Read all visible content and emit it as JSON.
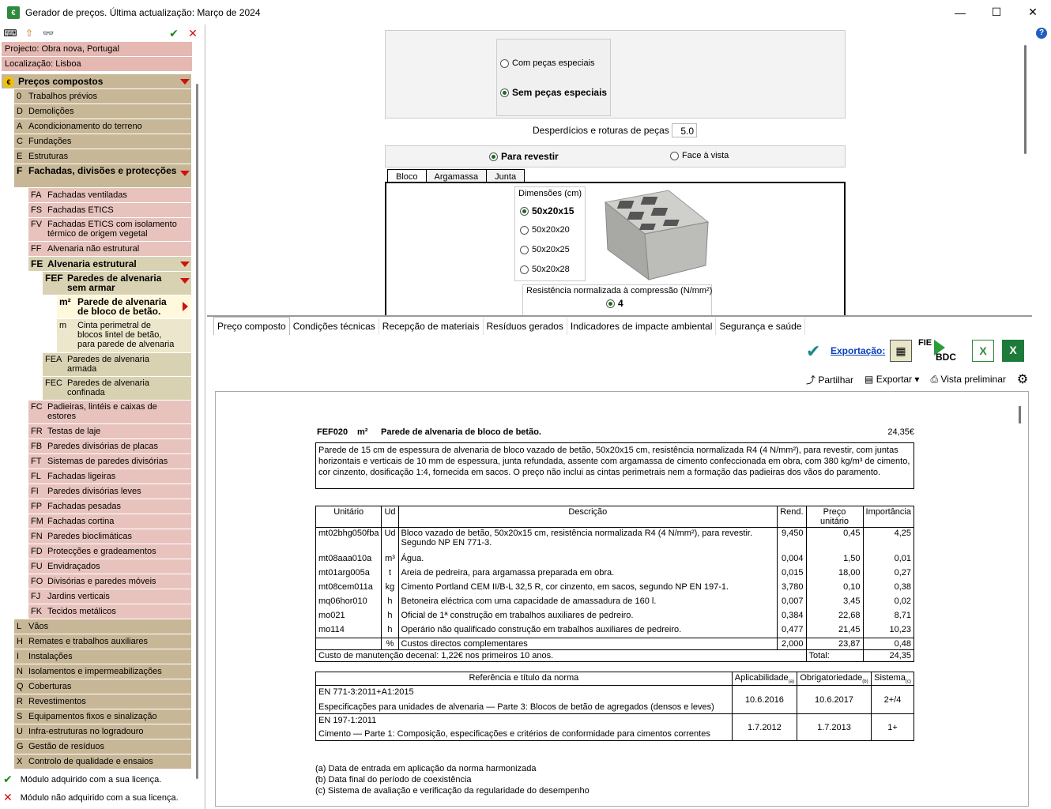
{
  "window": {
    "title": "Gerador de preços. Última actualização: Março de 2024",
    "minimize": "—",
    "maximize": "☐",
    "close": "✕"
  },
  "left": {
    "project": "Projecto: Obra nova, Portugal",
    "location": "Localização: Lisboa",
    "root": "Preços compostos",
    "chapters_top": [
      {
        "code": "0",
        "label": "Trabalhos prévios"
      },
      {
        "code": "D",
        "label": "Demolições"
      },
      {
        "code": "A",
        "label": "Acondicionamento do terreno"
      },
      {
        "code": "C",
        "label": "Fundações"
      },
      {
        "code": "E",
        "label": "Estruturas"
      }
    ],
    "chapter_f": {
      "code": "F",
      "label": "Fachadas, divisões e protecções"
    },
    "f_items_a": [
      {
        "code": "FA",
        "label": "Fachadas ventiladas"
      },
      {
        "code": "FS",
        "label": "Fachadas ETICS"
      },
      {
        "code": "FV",
        "label": "Fachadas ETICS com isolamento térmico de origem vegetal"
      },
      {
        "code": "FF",
        "label": "Alvenaria não estrutural"
      }
    ],
    "fe": {
      "code": "FE",
      "label": "Alvenaria estrutural"
    },
    "fef": {
      "code": "FEF",
      "label": "Paredes de alvenaria sem armar"
    },
    "m2": {
      "code": "m²",
      "label": "Parede de alvenaria de bloco de betão."
    },
    "m": {
      "code": "m",
      "label": "Cinta perimetral de blocos lintel de betão, para parede de alvenaria"
    },
    "fea": {
      "code": "FEA",
      "label": "Paredes de alvenaria armada"
    },
    "fec": {
      "code": "FEC",
      "label": "Paredes de alvenaria confinada"
    },
    "f_items_b": [
      {
        "code": "FC",
        "label": "Padieiras, lintéis e caixas de estores"
      },
      {
        "code": "FR",
        "label": "Testas de laje"
      },
      {
        "code": "FB",
        "label": "Paredes divisórias de placas"
      },
      {
        "code": "FT",
        "label": "Sistemas de paredes divisórias"
      },
      {
        "code": "FL",
        "label": "Fachadas ligeiras"
      },
      {
        "code": "FI",
        "label": "Paredes divisórias leves"
      },
      {
        "code": "FP",
        "label": "Fachadas pesadas"
      },
      {
        "code": "FM",
        "label": "Fachadas cortina"
      },
      {
        "code": "FN",
        "label": "Paredes bioclimáticas"
      },
      {
        "code": "FD",
        "label": "Protecções e gradeamentos"
      },
      {
        "code": "FU",
        "label": "Envidraçados"
      },
      {
        "code": "FO",
        "label": "Divisórias e paredes móveis"
      },
      {
        "code": "FJ",
        "label": "Jardins verticais"
      },
      {
        "code": "FK",
        "label": "Tecidos metálicos"
      }
    ],
    "chapters_bottom": [
      {
        "code": "L",
        "label": "Vãos"
      },
      {
        "code": "H",
        "label": "Remates e trabalhos auxiliares"
      },
      {
        "code": "I",
        "label": "Instalações"
      },
      {
        "code": "N",
        "label": "Isolamentos e impermeabilizações"
      },
      {
        "code": "Q",
        "label": "Coberturas"
      },
      {
        "code": "R",
        "label": "Revestimentos"
      },
      {
        "code": "S",
        "label": "Equipamentos fixos e sinalização"
      },
      {
        "code": "U",
        "label": "Infra-estruturas no logradouro"
      },
      {
        "code": "G",
        "label": "Gestão de resíduos"
      },
      {
        "code": "X",
        "label": "Controlo de qualidade e ensaios"
      }
    ],
    "legend_ok": "Módulo adquirido com a sua licença.",
    "legend_no": "Módulo não adquirido com a sua licença."
  },
  "options": {
    "special_on": "Com peças especiais",
    "special_off": "Sem peças especiais",
    "waste_label": "Desperdícios e roturas de peças (%)",
    "waste_value": "5.0",
    "finish_render": "Para revestir",
    "finish_face": "Face à vista",
    "tabs": [
      "Bloco",
      "Argamassa",
      "Junta"
    ],
    "dims_title": "Dimensões (cm)",
    "dims": [
      "50x20x15",
      "50x20x20",
      "50x20x25",
      "50x20x28"
    ],
    "resist_title": "Resistência normalizada à compressão (N/mm²)",
    "resist_value": "4"
  },
  "bottom": {
    "tabs": [
      "Preço composto",
      "Condições técnicas",
      "Recepção de materiais",
      "Resíduos gerados",
      "Indicadores de impacte ambiental",
      "Segurança e saúde"
    ],
    "export_link": "Exportação:",
    "fie": "FIE",
    "bdc": "BDC",
    "share": "Partilhar",
    "export": "Exportar",
    "preview": "Vista preliminar"
  },
  "doc": {
    "code": "FEF020",
    "unit": "m²",
    "title": "Parede de alvenaria de bloco de betão.",
    "price": "24,35€",
    "description": "Parede de 15 cm de espessura de alvenaria de bloco vazado de betão, 50x20x15 cm, resistência normalizada R4 (4 N/mm²), para revestir, com juntas horizontais e verticais de 10 mm de espessura, junta refundada, assente com argamassa de cimento confeccionada em obra, com 380 kg/m³ de cimento, cor cinzento, dosificação 1:4, fornecida em sacos. O preço não inclui as cintas perimetrais nem a formação das padieiras dos vãos do paramento.",
    "headers": [
      "Unitário",
      "Ud",
      "Descrição",
      "Rend.",
      "Preço unitário",
      "Importância"
    ],
    "rows": [
      [
        "mt02bhg050fba",
        "Ud",
        "Bloco vazado de betão, 50x20x15 cm, resistência normalizada R4 (4 N/mm²), para revestir. Segundo NP EN 771-3.",
        "9,450",
        "0,45",
        "4,25"
      ],
      [
        "mt08aaa010a",
        "m³",
        "Água.",
        "0,004",
        "1,50",
        "0,01"
      ],
      [
        "mt01arg005a",
        "t",
        "Areia de pedreira, para argamassa preparada em obra.",
        "0,015",
        "18,00",
        "0,27"
      ],
      [
        "mt08cem011a",
        "kg",
        "Cimento Portland CEM II/B-L 32,5 R, cor cinzento, em sacos, segundo NP EN 197-1.",
        "3,780",
        "0,10",
        "0,38"
      ],
      [
        "mq06hor010",
        "h",
        "Betoneira eléctrica com uma capacidade de amassadura de 160 l.",
        "0,007",
        "3,45",
        "0,02"
      ],
      [
        "mo021",
        "h",
        "Oficial de 1ª construção em trabalhos auxiliares de pedreiro.",
        "0,384",
        "22,68",
        "8,71"
      ],
      [
        "mo114",
        "h",
        "Operário não qualificado construção em trabalhos auxiliares de pedreiro.",
        "0,477",
        "21,45",
        "10,23"
      ]
    ],
    "extra": [
      "",
      "%",
      "Custos directos complementares",
      "2,000",
      "23,87",
      "0,48"
    ],
    "maintenance": "Custo de manutenção decenal: 1,22€ nos primeiros 10 anos.",
    "total_label": "Total:",
    "total": "24,35",
    "norm_headers": [
      "Referência e título da norma",
      "Aplicabilidade",
      "Obrigatoriedade",
      "Sistema"
    ],
    "norm_sub": [
      "(a)",
      "(b)",
      "(c)"
    ],
    "norms": [
      {
        "ref": "EN  771-3:2011+A1:2015",
        "title": "Especificações para unidades de alvenaria — Parte 3: Blocos de betão de agregados (densos e leves)",
        "app": "10.6.2016",
        "obl": "10.6.2017",
        "sys": "2+/4"
      },
      {
        "ref": "EN  197-1:2011",
        "title": "Cimento — Parte 1: Composição, especificações e critérios de conformidade para cimentos correntes",
        "app": "1.7.2012",
        "obl": "1.7.2013",
        "sys": "1+"
      }
    ],
    "notes": [
      "(a) Data de entrada em aplicação da norma harmonizada",
      "(b) Data final do período de coexistência",
      "(c) Sistema de avaliação e verificação da regularidade do desempenho"
    ]
  }
}
